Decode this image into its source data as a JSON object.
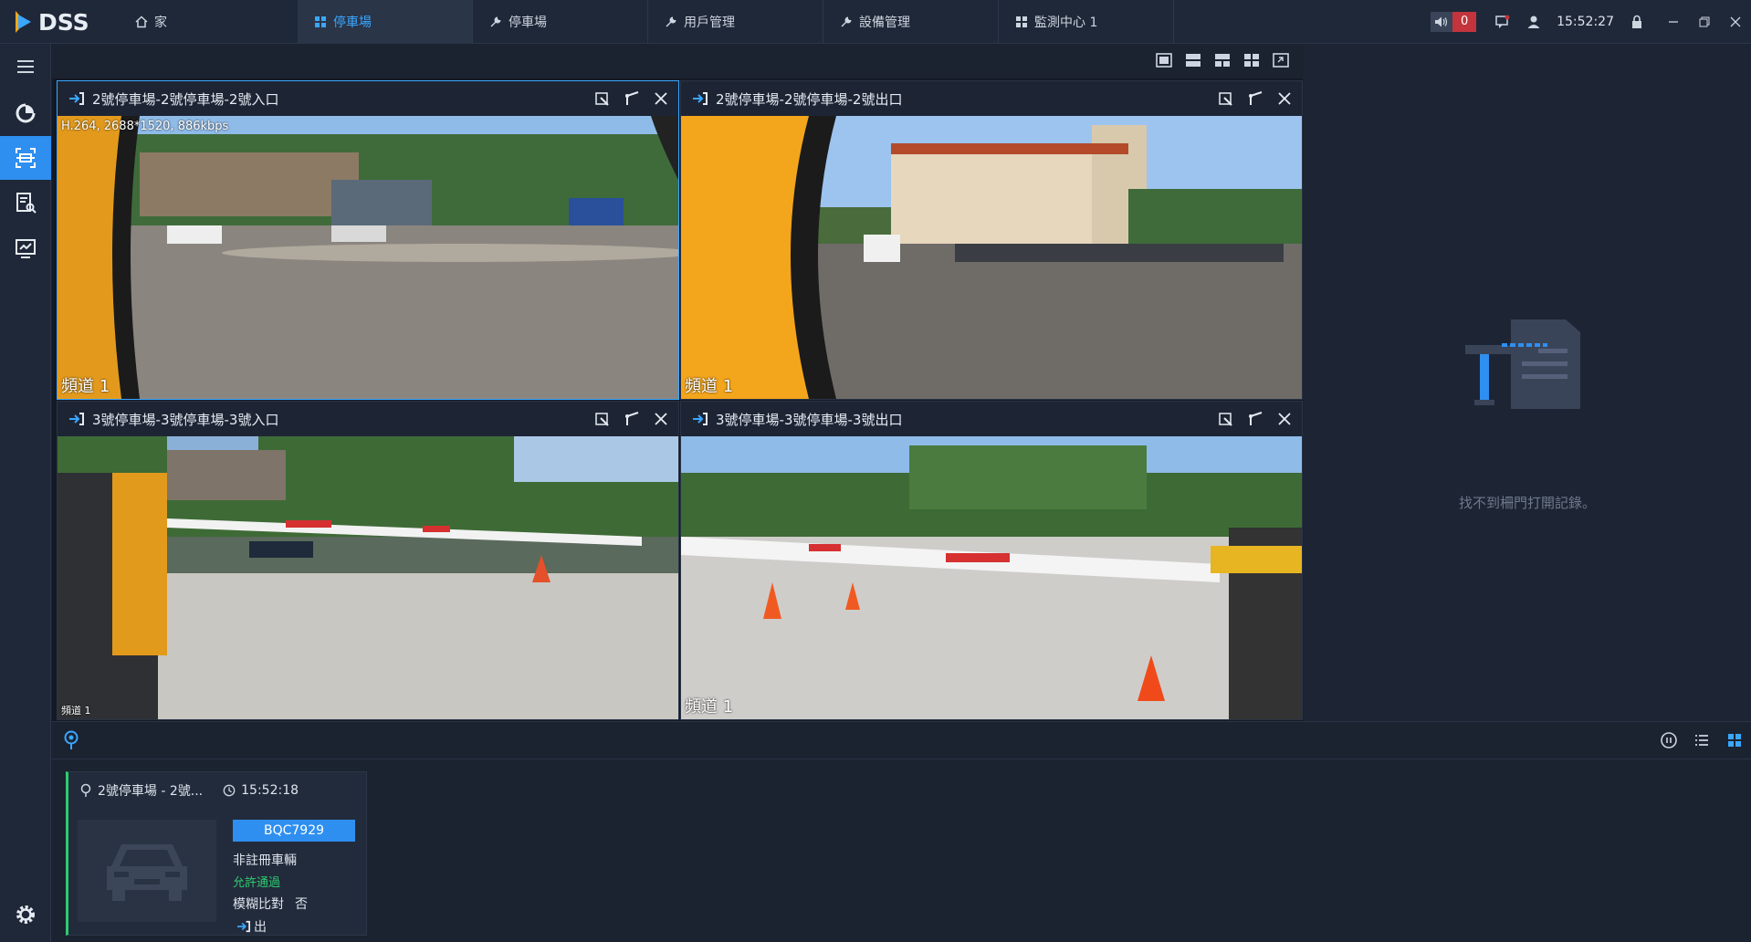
{
  "app": {
    "name": "DSS"
  },
  "nav_tabs": [
    {
      "label": "家",
      "icon": "home-icon"
    },
    {
      "label": "停車場",
      "icon": "grid-icon",
      "active": true
    },
    {
      "label": "停車場",
      "icon": "wrench-icon"
    },
    {
      "label": "用戶管理",
      "icon": "wrench-icon"
    },
    {
      "label": "設備管理",
      "icon": "wrench-icon"
    },
    {
      "label": "監測中心 1",
      "icon": "grid-icon"
    }
  ],
  "header": {
    "alarm_count": "0",
    "time": "15:52:27"
  },
  "sidebar": {
    "items": [
      "menu-icon",
      "refresh-icon",
      "parking-monitor-icon",
      "record-search-icon",
      "report-icon"
    ],
    "active_index": 2
  },
  "panes": [
    {
      "title": "2號停車場-2號停車場-2號入口",
      "channel": "頻道 1",
      "info": "H.264, 2688*1520, 886kbps",
      "selected": true
    },
    {
      "title": "2號停車場-2號停車場-2號出口",
      "channel": "頻道 1"
    },
    {
      "title": "3號停車場-3號停車場-3號入口",
      "channel": "頻道 1"
    },
    {
      "title": "3號停車場-3號停車場-3號出口",
      "channel": "頻道 1"
    }
  ],
  "right_panel": {
    "empty_text": "找不到柵門打開記錄。"
  },
  "record": {
    "location": "2號停車場 - 2號...",
    "time": "15:52:18",
    "plate": "BQC7929",
    "vehicle_type": "非註冊車輛",
    "status": "允許通過",
    "fuzzy_label": "模糊比對",
    "fuzzy_value": "否",
    "direction": "出"
  },
  "colors": {
    "accent": "#2e8ff0",
    "active_tab_text": "#3aa7ff",
    "allowed": "#2ecc71",
    "alarm": "#c3343c"
  }
}
